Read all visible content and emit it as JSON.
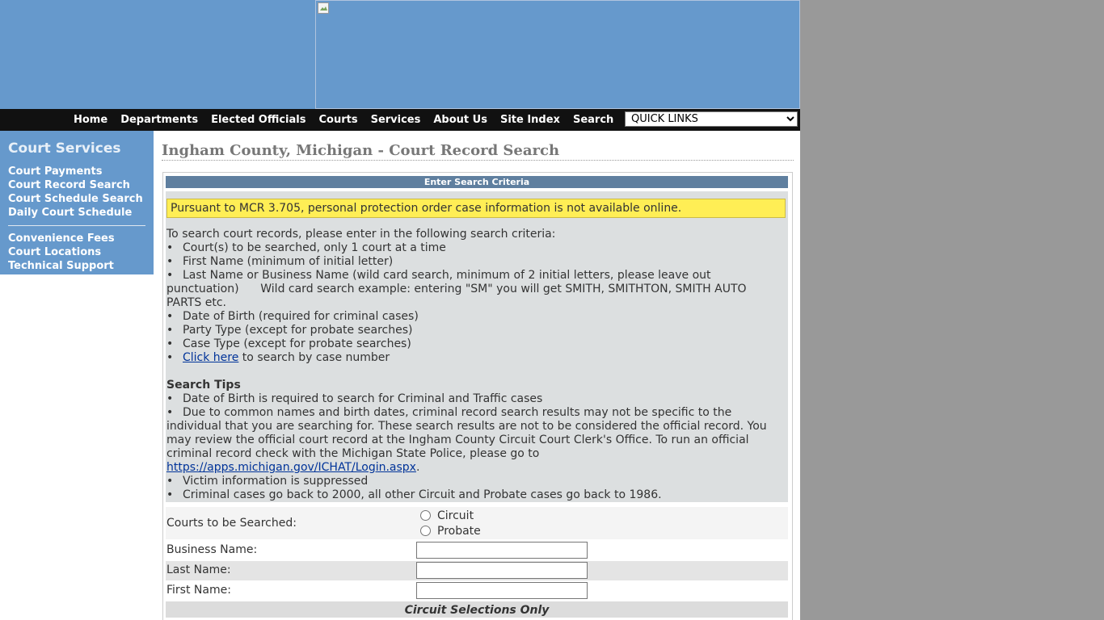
{
  "nav": {
    "items": [
      "Home",
      "Departments",
      "Elected Officials",
      "Courts",
      "Services",
      "About Us",
      "Site Index",
      "Search"
    ],
    "quick_links_selected": "QUICK LINKS"
  },
  "sidebar": {
    "title": "Court Services",
    "group1": [
      "Court Payments",
      "Court Record Search",
      "Court Schedule Search",
      "Daily Court Schedule"
    ],
    "group2": [
      "Convenience Fees",
      "Court Locations",
      "Technical Support"
    ]
  },
  "main": {
    "title": "Ingham County, Michigan - Court Record Search",
    "panel_header": "Enter Search Criteria",
    "ppo_notice": "Pursuant to MCR 3.705, personal protection order case information is not available online.",
    "intro": "To search court records, please enter in the following search criteria:",
    "criteria": [
      "Court(s) to be searched, only 1 court at a time",
      "First Name (minimum of initial letter)",
      "Last Name or Business Name (wild card search, minimum of 2 initial letters, please leave out punctuation)      Wild card search example: entering \"SM\" you will get SMITH, SMITHTON, SMITH AUTO PARTS etc.",
      "Date of Birth (required for criminal cases)",
      "Party Type (except for probate searches)",
      "Case Type (except for probate searches)"
    ],
    "click_here_link": "Click here",
    "click_here_suffix": " to search by case number",
    "tips_title": "Search Tips",
    "tip1": "Date of Birth is required to search for Criminal and Traffic cases",
    "tip2": "Due to common names and birth dates, criminal record search results may not be specific to the individual that you are searching for. These search results are not to be considered the official record. You may review the official court record at the Ingham County Circuit Court Clerk's Office. To run an official criminal record check with the Michigan State Police, please go to ",
    "tip2_link": "https://apps.michigan.gov/ICHAT/Login.aspx",
    "tip2_end": ".",
    "tip3": "Victim information is suppressed",
    "tip4": "Criminal cases go back to 2000, all other Circuit and Probate cases go back to 1986."
  },
  "form": {
    "courts_label": "Courts to be Searched:",
    "court_options": [
      "Circuit",
      "Probate"
    ],
    "business_label": "Business Name:",
    "last_label": "Last Name:",
    "first_label": "First Name:",
    "circuit_only": "Circuit Selections Only"
  }
}
